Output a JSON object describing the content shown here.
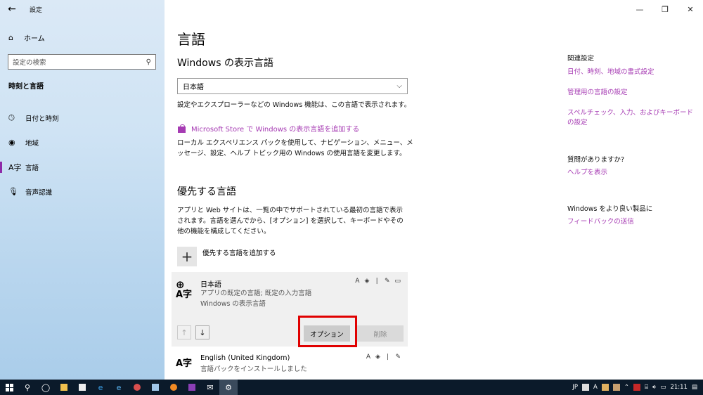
{
  "window": {
    "app_title": "設定",
    "back_glyph": "←",
    "min_glyph": "—",
    "max_glyph": "❐",
    "close_glyph": "✕"
  },
  "sidebar": {
    "home_label": "ホーム",
    "search_placeholder": "設定の検索",
    "section_title": "時刻と言語",
    "items": [
      {
        "label": "日付と時刻",
        "icon": "clock-icon"
      },
      {
        "label": "地域",
        "icon": "globe-icon"
      },
      {
        "label": "言語",
        "icon": "language-icon"
      },
      {
        "label": "音声認識",
        "icon": "microphone-icon"
      }
    ],
    "active_index": 2
  },
  "main": {
    "page_title": "言語",
    "display_language_title": "Windows の表示言語",
    "display_language_value": "日本語",
    "display_language_desc": "設定やエクスプローラーなどの Windows 機能は、この言語で表示されます。",
    "store_link": "Microsoft Store で Windows の表示言語を追加する",
    "local_experience_desc": "ローカル エクスペリエンス パックを使用して、ナビゲーション、メニュー、メッセージ、設定、ヘルプ トピック用の Windows の使用言語を変更します。",
    "preferred_title": "優先する言語",
    "preferred_desc": "アプリと Web サイトは、一覧の中でサポートされている最初の言語で表示されます。言語を選んでから、[オプション] を選択して、キーボードやその他の機能を構成してください。",
    "add_preferred_label": "優先する言語を追加する",
    "languages": [
      {
        "name": "日本語",
        "sub1": "アプリの既定の言語; 既定の入力言語",
        "sub2": "Windows の表示言語"
      },
      {
        "name": "English (United Kingdom)",
        "sub1": "言語パックをインストールしました"
      }
    ],
    "options_button": "オプション",
    "remove_button": "削除"
  },
  "related": {
    "title": "関連設定",
    "links": [
      "日付、時刻、地域の書式設定",
      "管理用の言語の設定",
      "スペルチェック、入力、およびキーボードの設定"
    ],
    "question_title": "質問がありますか?",
    "help_link": "ヘルプを表示",
    "feedback_title": "Windows をより良い製品に",
    "feedback_link": "フィードバックの送信"
  },
  "taskbar": {
    "ime": "JP",
    "clock": "21:11"
  },
  "colors": {
    "accent": "#a63bb3",
    "highlight": "#e00000",
    "taskbar": "#0b1a2a"
  }
}
